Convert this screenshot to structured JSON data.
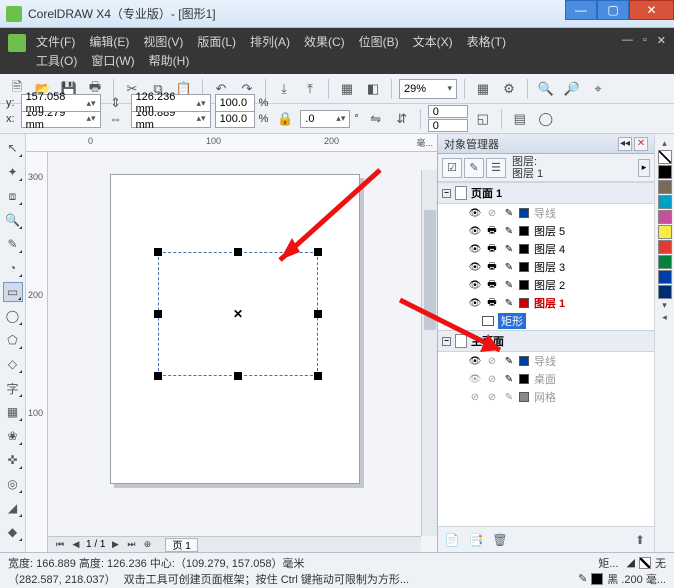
{
  "window": {
    "title": "CorelDRAW X4（专业版）- [图形1]"
  },
  "menu": {
    "row1": [
      "文件(F)",
      "编辑(E)",
      "视图(V)",
      "版面(L)",
      "排列(A)",
      "效果(C)",
      "位图(B)",
      "文本(X)",
      "表格(T)"
    ],
    "row2": [
      "工具(O)",
      "窗口(W)",
      "帮助(H)"
    ]
  },
  "toolbar1": {
    "zoom": "29%"
  },
  "coords": {
    "x_label": "x:",
    "x": "109.279 mm",
    "y_label": "y:",
    "y": "157.058 mm",
    "w": "166.889 mm",
    "h": "126.236 mm",
    "sx": "100.0",
    "sy": "100.0",
    "sx_unit": "%",
    "sy_unit": "%",
    "angle": ".0",
    "deg": "°",
    "nx": "0",
    "ny": "0"
  },
  "ruler_h": [
    "0",
    "100",
    "200"
  ],
  "ruler_h_extra": "毫...",
  "ruler_v": [
    "300",
    "200",
    "100"
  ],
  "page_nav": {
    "page": "1 / 1",
    "tab": "页 1"
  },
  "docker": {
    "title": "对象管理器",
    "layer_label": "图层:",
    "layer_value": "图层 1",
    "page_header": "页面 1",
    "layers_page": [
      "导线",
      "图层 5",
      "图层 4",
      "图层 3",
      "图层 2",
      "图层 1"
    ],
    "object": "矩形",
    "master_header": "主页面",
    "layers_master": [
      "导线",
      "桌面",
      "网格"
    ]
  },
  "status": {
    "line1_dims": "宽度: 166.889 高度: 126.236 中心:（109.279, 157.058）毫米",
    "line1_obj": "矩...",
    "line2_coords": "（282.587, 218.037）",
    "line2_hint": "双击工具可创建页面框架；按住 Ctrl 键拖动可限制为方形...",
    "fill_none": "无",
    "outline": "黑 .200 毫..."
  },
  "palette_colors": [
    "#000000",
    "#7a6a58",
    "#00a0c6",
    "#c94f9a",
    "#f7ea48",
    "#e03c31",
    "#00843d",
    "#003da5",
    "#002d72"
  ]
}
